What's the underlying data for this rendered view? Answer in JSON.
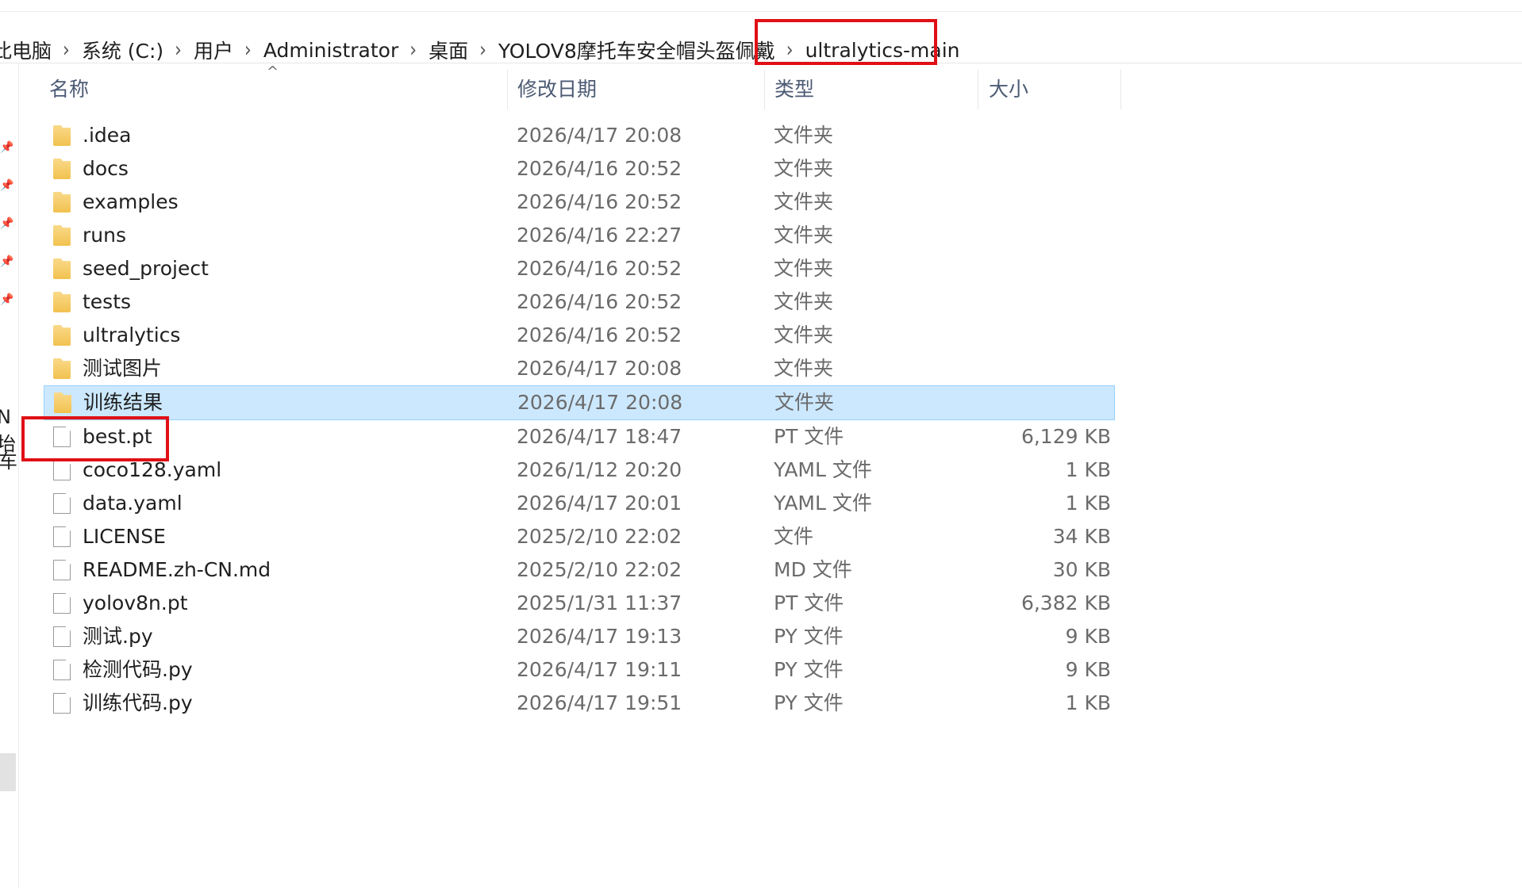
{
  "breadcrumb": {
    "items": [
      "此电脑",
      "系统 (C:)",
      "用户",
      "Administrator",
      "桌面",
      "YOLOV8摩托车安全帽头盔佩戴",
      "ultralytics-main"
    ],
    "separator": "›"
  },
  "columns": {
    "name": "名称",
    "date": "修改日期",
    "type": "类型",
    "size": "大小"
  },
  "sidebar": {
    "fragment_1": "N",
    "fragment_1b": "坮",
    "fragment_2": "车"
  },
  "rows": [
    {
      "name": ".idea",
      "date": "2026/4/17 20:08",
      "type": "文件夹",
      "size": "",
      "kind": "folder"
    },
    {
      "name": "docs",
      "date": "2026/4/16 20:52",
      "type": "文件夹",
      "size": "",
      "kind": "folder"
    },
    {
      "name": "examples",
      "date": "2026/4/16 20:52",
      "type": "文件夹",
      "size": "",
      "kind": "folder"
    },
    {
      "name": "runs",
      "date": "2026/4/16 22:27",
      "type": "文件夹",
      "size": "",
      "kind": "folder"
    },
    {
      "name": "seed_project",
      "date": "2026/4/16 20:52",
      "type": "文件夹",
      "size": "",
      "kind": "folder"
    },
    {
      "name": "tests",
      "date": "2026/4/16 20:52",
      "type": "文件夹",
      "size": "",
      "kind": "folder"
    },
    {
      "name": "ultralytics",
      "date": "2026/4/16 20:52",
      "type": "文件夹",
      "size": "",
      "kind": "folder"
    },
    {
      "name": "测试图片",
      "date": "2026/4/17 20:08",
      "type": "文件夹",
      "size": "",
      "kind": "folder"
    },
    {
      "name": "训练结果",
      "date": "2026/4/17 20:08",
      "type": "文件夹",
      "size": "",
      "kind": "folder",
      "selected": true
    },
    {
      "name": "best.pt",
      "date": "2026/4/17 18:47",
      "type": "PT 文件",
      "size": "6,129 KB",
      "kind": "file"
    },
    {
      "name": "coco128.yaml",
      "date": "2026/1/12 20:20",
      "type": "YAML 文件",
      "size": "1 KB",
      "kind": "file"
    },
    {
      "name": "data.yaml",
      "date": "2026/4/17 20:01",
      "type": "YAML 文件",
      "size": "1 KB",
      "kind": "file"
    },
    {
      "name": "LICENSE",
      "date": "2025/2/10 22:02",
      "type": "文件",
      "size": "34 KB",
      "kind": "file"
    },
    {
      "name": "README.zh-CN.md",
      "date": "2025/2/10 22:02",
      "type": "MD 文件",
      "size": "30 KB",
      "kind": "file"
    },
    {
      "name": "yolov8n.pt",
      "date": "2025/1/31 11:37",
      "type": "PT 文件",
      "size": "6,382 KB",
      "kind": "file"
    },
    {
      "name": "测试.py",
      "date": "2026/4/17 19:13",
      "type": "PY 文件",
      "size": "9 KB",
      "kind": "file"
    },
    {
      "name": "检测代码.py",
      "date": "2026/4/17 19:11",
      "type": "PY 文件",
      "size": "9 KB",
      "kind": "file"
    },
    {
      "name": "训练代码.py",
      "date": "2026/4/17 19:51",
      "type": "PY 文件",
      "size": "1 KB",
      "kind": "file"
    }
  ],
  "colors": {
    "highlight": "#e01016",
    "selection": "#cce8ff",
    "folder": "#f2c24f"
  }
}
